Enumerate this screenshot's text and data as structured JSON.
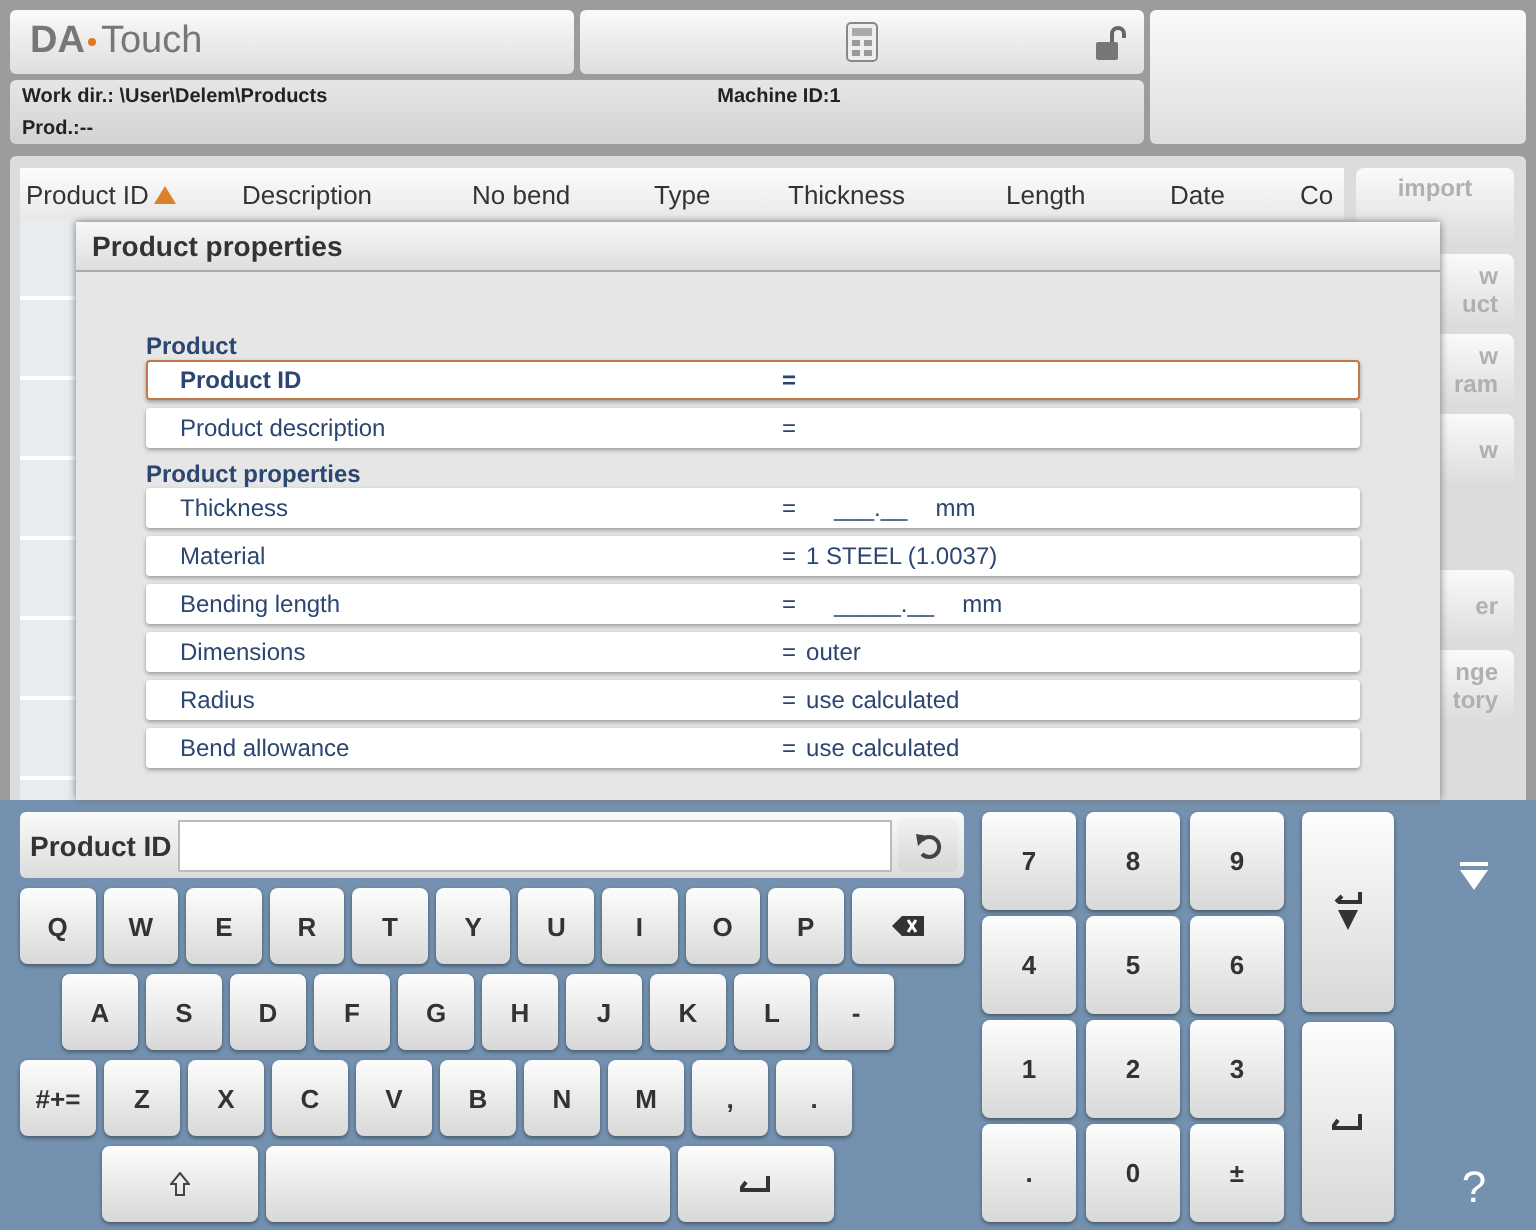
{
  "header": {
    "logo_brand": "DA",
    "logo_suffix": "Touch",
    "work_dir": "Work dir.: \\User\\Delem\\Products",
    "machine_id": "Machine ID:1",
    "product": "Prod.:--"
  },
  "table": {
    "columns": [
      {
        "label": "Product ID",
        "sorted": true
      },
      {
        "label": "Description",
        "sorted": false
      },
      {
        "label": "No bend",
        "sorted": false
      },
      {
        "label": "Type",
        "sorted": false
      },
      {
        "label": "Thickness",
        "sorted": false
      },
      {
        "label": "Length",
        "sorted": false
      },
      {
        "label": "Date",
        "sorted": false
      },
      {
        "label": "Co",
        "sorted": false
      }
    ]
  },
  "side_buttons": [
    {
      "lines": [
        "import"
      ]
    },
    {
      "lines": [
        "w",
        "uct"
      ]
    },
    {
      "lines": [
        "w",
        "ram"
      ]
    },
    {
      "lines": [
        "w"
      ]
    },
    {
      "lines": [
        "er"
      ]
    },
    {
      "lines": [
        "nge",
        "tory"
      ]
    }
  ],
  "dialog": {
    "title": "Product properties",
    "sections": [
      {
        "heading": "Product",
        "rows": [
          {
            "label": "Product ID",
            "sign": "=",
            "selected": true
          },
          {
            "label": "Product description",
            "sign": "=",
            "selected": false
          }
        ]
      },
      {
        "heading": "Product properties",
        "rows": [
          {
            "label": "Thickness",
            "sign": "=",
            "value": "___.__",
            "unit": "mm",
            "selected": false
          },
          {
            "label": "Material",
            "sign": "=",
            "value": "1 STEEL (1.0037)",
            "selected": false
          },
          {
            "label": "Bending length",
            "sign": "=",
            "value": "_____.__",
            "unit": "mm",
            "selected": false
          },
          {
            "label": "Dimensions",
            "sign": "=",
            "value": "outer",
            "selected": false
          },
          {
            "label": "Radius",
            "sign": "=",
            "value": "use calculated",
            "selected": false
          },
          {
            "label": "Bend allowance",
            "sign": "=",
            "value": "use calculated",
            "selected": false
          }
        ]
      }
    ]
  },
  "keyboard": {
    "field_label": "Product ID",
    "rows": [
      [
        {
          "kind": "char",
          "label": "Q"
        },
        {
          "kind": "char",
          "label": "W"
        },
        {
          "kind": "char",
          "label": "E"
        },
        {
          "kind": "char",
          "label": "R"
        },
        {
          "kind": "char",
          "label": "T"
        },
        {
          "kind": "char",
          "label": "Y"
        },
        {
          "kind": "char",
          "label": "U"
        },
        {
          "kind": "char",
          "label": "I"
        },
        {
          "kind": "char",
          "label": "O"
        },
        {
          "kind": "char",
          "label": "P"
        },
        {
          "kind": "backspace"
        }
      ],
      [
        {
          "kind": "char",
          "label": "A"
        },
        {
          "kind": "char",
          "label": "S"
        },
        {
          "kind": "char",
          "label": "D"
        },
        {
          "kind": "char",
          "label": "F"
        },
        {
          "kind": "char",
          "label": "G"
        },
        {
          "kind": "char",
          "label": "H"
        },
        {
          "kind": "char",
          "label": "J"
        },
        {
          "kind": "char",
          "label": "K"
        },
        {
          "kind": "char",
          "label": "L"
        },
        {
          "kind": "char",
          "label": "-"
        }
      ],
      [
        {
          "kind": "char",
          "label": "#+="
        },
        {
          "kind": "char",
          "label": "Z"
        },
        {
          "kind": "char",
          "label": "X"
        },
        {
          "kind": "char",
          "label": "C"
        },
        {
          "kind": "char",
          "label": "V"
        },
        {
          "kind": "char",
          "label": "B"
        },
        {
          "kind": "char",
          "label": "N"
        },
        {
          "kind": "char",
          "label": "M"
        },
        {
          "kind": "char",
          "label": ","
        },
        {
          "kind": "char",
          "label": "."
        }
      ],
      [
        {
          "kind": "shift"
        },
        {
          "kind": "space"
        },
        {
          "kind": "enter"
        }
      ]
    ],
    "numpad": [
      {
        "label": "7"
      },
      {
        "label": "8"
      },
      {
        "label": "9"
      },
      {
        "label": "4"
      },
      {
        "label": "5"
      },
      {
        "label": "6"
      },
      {
        "label": "1"
      },
      {
        "label": "2"
      },
      {
        "label": "3"
      },
      {
        "label": "."
      },
      {
        "label": "0"
      },
      {
        "label": "±"
      }
    ],
    "help": "?"
  }
}
